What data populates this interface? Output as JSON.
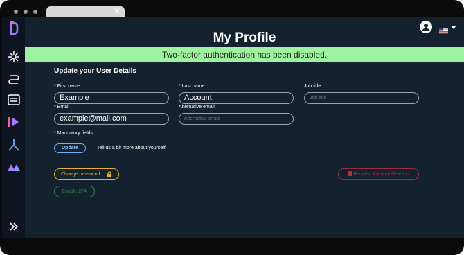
{
  "page": {
    "title": "My Profile",
    "banner": "Two-factor authentication has been disabled.",
    "section_title": "Update your User Details"
  },
  "form": {
    "first_name": {
      "label": "* First name",
      "value": "Example"
    },
    "last_name": {
      "label": "* Last name",
      "value": "Account"
    },
    "job_title": {
      "label": "Job title",
      "placeholder": "Job title"
    },
    "email": {
      "label": "* Email",
      "value": "example@mail.com"
    },
    "alt_email": {
      "label": "Alternative email",
      "placeholder": "Alternative email"
    },
    "mandatory_note": "* Mandatory fields",
    "update_label": "Update",
    "tell_more": "Tell us a bit more about yourself"
  },
  "actions": {
    "change_password": "Change password",
    "enable_2fa": "Enable 2FA",
    "request_deletion": "Request Account Deletion"
  },
  "colors": {
    "background": "#14222f",
    "sidebar": "#0c1520",
    "banner": "#9ff29f",
    "update_accent": "#6fb1ff",
    "password_accent": "#e1b22f",
    "enable_2fa_accent": "#238a44",
    "delete_accent": "#b0323d"
  },
  "icons": {
    "sidebar": [
      "app-logo-icon",
      "network-icon",
      "workflow-icon",
      "catalog-icon",
      "data-icon",
      "branch-icon",
      "monitoring-icon",
      "expand-icon"
    ],
    "header": [
      "user-avatar-icon",
      "us-flag-icon",
      "chevron-down-icon"
    ]
  }
}
